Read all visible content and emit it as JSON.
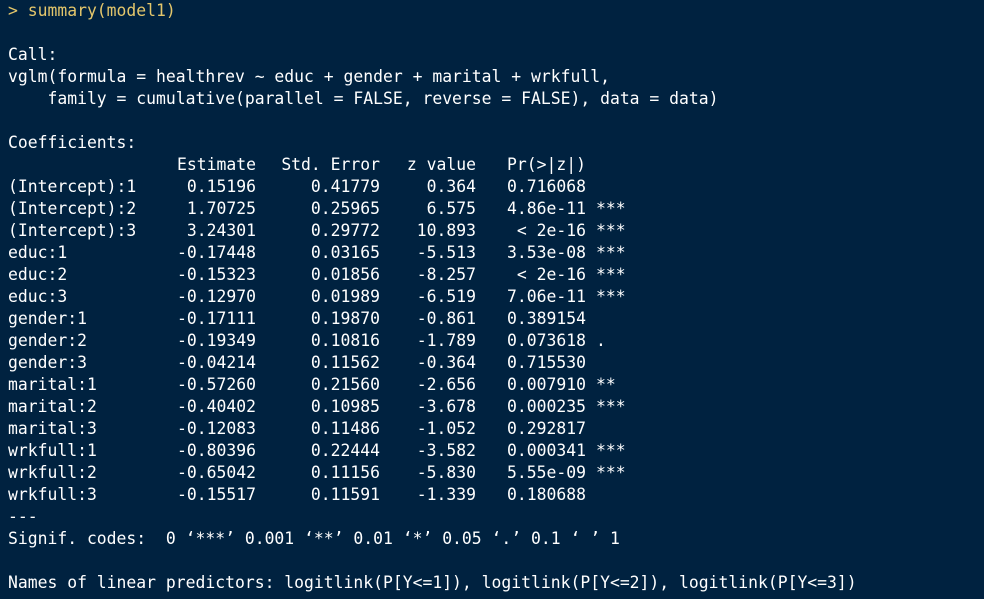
{
  "console": {
    "prompt_command": "> summary(model1)",
    "call_header": "Call:",
    "call_line1": "vglm(formula = healthrev ~ educ + gender + marital + wrkfull,",
    "call_line2": "    family = cumulative(parallel = FALSE, reverse = FALSE), data = data)",
    "coefficients_header": "Coefficients:",
    "table_headers": [
      "",
      "Estimate",
      "Std. Error",
      "z value",
      "Pr(>|z|)",
      ""
    ],
    "rows": [
      {
        "name": "(Intercept):1",
        "estimate": "0.15196",
        "std_error": "0.41779",
        "z_value": "0.364",
        "p_value": "0.716068",
        "signif": ""
      },
      {
        "name": "(Intercept):2",
        "estimate": "1.70725",
        "std_error": "0.25965",
        "z_value": "6.575",
        "p_value": "4.86e-11",
        "signif": "***"
      },
      {
        "name": "(Intercept):3",
        "estimate": "3.24301",
        "std_error": "0.29772",
        "z_value": "10.893",
        "p_value": "< 2e-16",
        "signif": "***"
      },
      {
        "name": "educ:1",
        "estimate": "-0.17448",
        "std_error": "0.03165",
        "z_value": "-5.513",
        "p_value": "3.53e-08",
        "signif": "***"
      },
      {
        "name": "educ:2",
        "estimate": "-0.15323",
        "std_error": "0.01856",
        "z_value": "-8.257",
        "p_value": "< 2e-16",
        "signif": "***"
      },
      {
        "name": "educ:3",
        "estimate": "-0.12970",
        "std_error": "0.01989",
        "z_value": "-6.519",
        "p_value": "7.06e-11",
        "signif": "***"
      },
      {
        "name": "gender:1",
        "estimate": "-0.17111",
        "std_error": "0.19870",
        "z_value": "-0.861",
        "p_value": "0.389154",
        "signif": ""
      },
      {
        "name": "gender:2",
        "estimate": "-0.19349",
        "std_error": "0.10816",
        "z_value": "-1.789",
        "p_value": "0.073618",
        "signif": "."
      },
      {
        "name": "gender:3",
        "estimate": "-0.04214",
        "std_error": "0.11562",
        "z_value": "-0.364",
        "p_value": "0.715530",
        "signif": ""
      },
      {
        "name": "marital:1",
        "estimate": "-0.57260",
        "std_error": "0.21560",
        "z_value": "-2.656",
        "p_value": "0.007910",
        "signif": "**"
      },
      {
        "name": "marital:2",
        "estimate": "-0.40402",
        "std_error": "0.10985",
        "z_value": "-3.678",
        "p_value": "0.000235",
        "signif": "***"
      },
      {
        "name": "marital:3",
        "estimate": "-0.12083",
        "std_error": "0.11486",
        "z_value": "-1.052",
        "p_value": "0.292817",
        "signif": ""
      },
      {
        "name": "wrkfull:1",
        "estimate": "-0.80396",
        "std_error": "0.22444",
        "z_value": "-3.582",
        "p_value": "0.000341",
        "signif": "***"
      },
      {
        "name": "wrkfull:2",
        "estimate": "-0.65042",
        "std_error": "0.11156",
        "z_value": "-5.830",
        "p_value": "5.55e-09",
        "signif": "***"
      },
      {
        "name": "wrkfull:3",
        "estimate": "-0.15517",
        "std_error": "0.11591",
        "z_value": "-1.339",
        "p_value": "0.180688",
        "signif": ""
      }
    ],
    "separator": "---",
    "signif_codes": "Signif. codes:  0 ‘***’ 0.001 ‘**’ 0.01 ‘*’ 0.05 ‘.’ 0.1 ‘ ’ 1",
    "linear_predictors": "Names of linear predictors: logitlink(P[Y<=1]), logitlink(P[Y<=2]), logitlink(P[Y<=3])"
  },
  "colors": {
    "background": "#002240",
    "text": "#ffffff",
    "command": "#e3c66b"
  }
}
